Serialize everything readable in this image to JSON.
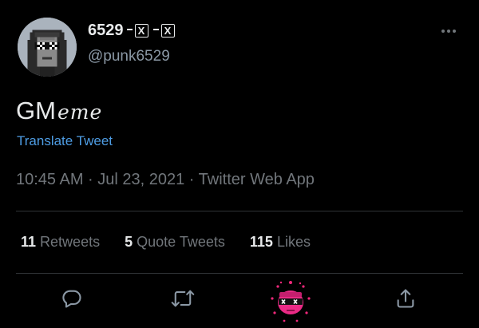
{
  "author": {
    "display_name": "6529",
    "handle": "@punk6529",
    "name_decorations": [
      "X",
      "X"
    ],
    "avatar_icon": "cryptopunk-avatar"
  },
  "tweet": {
    "text_main": "GM",
    "text_styled": "eme",
    "translate_label": "Translate Tweet",
    "timestamp": "10:45 AM · Jul 23, 2021 · Twitter Web App"
  },
  "stats": {
    "retweets_count": "11",
    "retweets_label": "Retweets",
    "quotes_count": "5",
    "quotes_label": "Quote Tweets",
    "likes_count": "115",
    "likes_label": "Likes"
  },
  "actions": {
    "reply_icon": "reply-icon",
    "retweet_icon": "retweet-icon",
    "like_icon": "punk-like-icon",
    "share_icon": "share-icon"
  },
  "colors": {
    "background": "#000000",
    "text": "#e7e9ea",
    "secondary": "#71767b",
    "link": "#4e9de4",
    "like_accent": "#f0287a"
  }
}
